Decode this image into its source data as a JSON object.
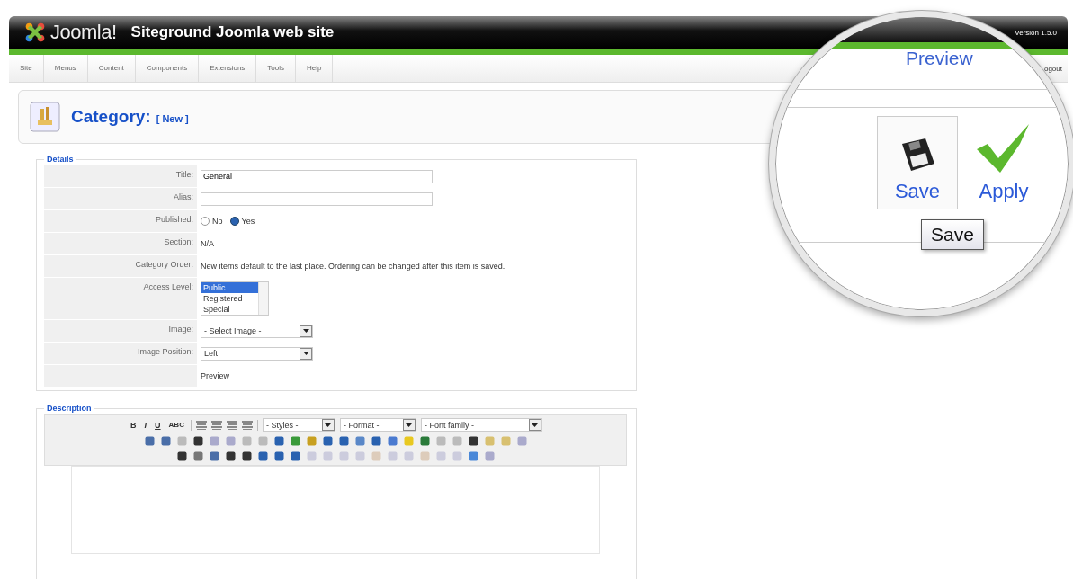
{
  "header": {
    "logo": "Joomla!",
    "site_title": "Siteground Joomla web site",
    "version": "Version 1.5.0"
  },
  "menu": [
    {
      "label": "Site"
    },
    {
      "label": "Menus"
    },
    {
      "label": "Content"
    },
    {
      "label": "Components"
    },
    {
      "label": "Extensions"
    },
    {
      "label": "Tools"
    },
    {
      "label": "Help"
    }
  ],
  "logout": "ogout",
  "page_title": {
    "label": "Category:",
    "sub": "[ New ]"
  },
  "magnifier": {
    "preview": "Preview",
    "buttons": [
      {
        "label": "Save",
        "hovered": true
      },
      {
        "label": "Apply",
        "hovered": false
      }
    ],
    "tooltip": "Save"
  },
  "details": {
    "legend": "Details",
    "rows": [
      {
        "kind": "text",
        "label": "Title:",
        "value": "General"
      },
      {
        "kind": "text",
        "label": "Alias:",
        "value": ""
      },
      {
        "kind": "radio",
        "label": "Published:",
        "options": [
          {
            "label": "No",
            "selected": false
          },
          {
            "label": "Yes",
            "selected": true
          }
        ]
      },
      {
        "kind": "plain",
        "label": "Section:",
        "value": "N/A"
      },
      {
        "kind": "plain",
        "label": "Category Order:",
        "value": "New items default to the last place. Ordering can be changed after this item is saved."
      },
      {
        "kind": "list",
        "label": "Access Level:",
        "options": [
          {
            "label": "Public",
            "selected": true
          },
          {
            "label": "Registered",
            "selected": false
          },
          {
            "label": "Special",
            "selected": false
          }
        ]
      },
      {
        "kind": "select",
        "label": "Image:",
        "value": "- Select Image -"
      },
      {
        "kind": "select",
        "label": "Image Position:",
        "value": "Left"
      },
      {
        "kind": "plain",
        "label": "",
        "value": "Preview"
      }
    ]
  },
  "description": {
    "legend": "Description",
    "format_buttons": [
      "B",
      "I",
      "U",
      "ABC"
    ],
    "dropdowns": [
      "- Styles -",
      "- Format -",
      "- Font family -"
    ]
  }
}
